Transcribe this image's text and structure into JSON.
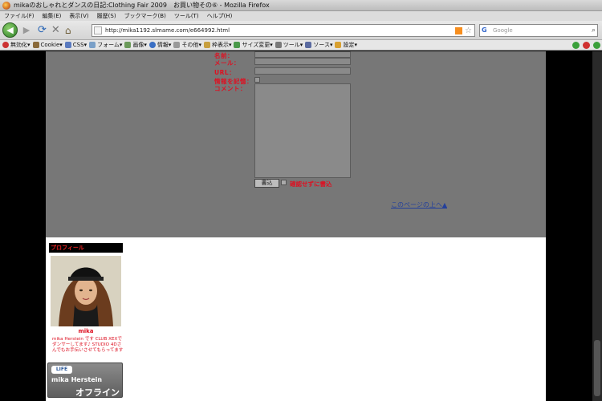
{
  "window": {
    "title": "mikaのおしゃれとダンスの日記:Clothing Fair 2009　お買い物その⑥ - Mozilla Firefox"
  },
  "menu": [
    "ファイル(F)",
    "編集(E)",
    "表示(V)",
    "履歴(S)",
    "ブックマーク(B)",
    "ツール(T)",
    "ヘルプ(H)"
  ],
  "address": {
    "url": "http://mika1192.slmame.com/e664992.html",
    "search_placeholder": "Google"
  },
  "toolbar": [
    "無効化",
    "Cookie",
    "CSS",
    "フォーム",
    "画像",
    "情報",
    "その他",
    "枠表示",
    "サイズ変更",
    "ツール",
    "ソース",
    "設定"
  ],
  "form": {
    "name_label": "名前：",
    "mail_label": "メール：",
    "url_label": "URL：",
    "remember_label": "情報を記憶：",
    "comment_label": "コメント：",
    "submit_label": "書込",
    "nopreview_label": "確認せずに書込"
  },
  "page_top_link": "このページの上へ▲",
  "profile": {
    "header": "プロフィール",
    "name": "mika",
    "description": "mika Herstein  です CLUB XEXでダンサーしてます♪ STUDIO 4Dさんでもお手伝いさせてもらってます",
    "sl_logo": "LIFE",
    "sl_name": "mika Herstein",
    "sl_status": "オフライン"
  },
  "colors": {
    "accent_red": "#dd1122",
    "link_blue": "#24409b"
  }
}
